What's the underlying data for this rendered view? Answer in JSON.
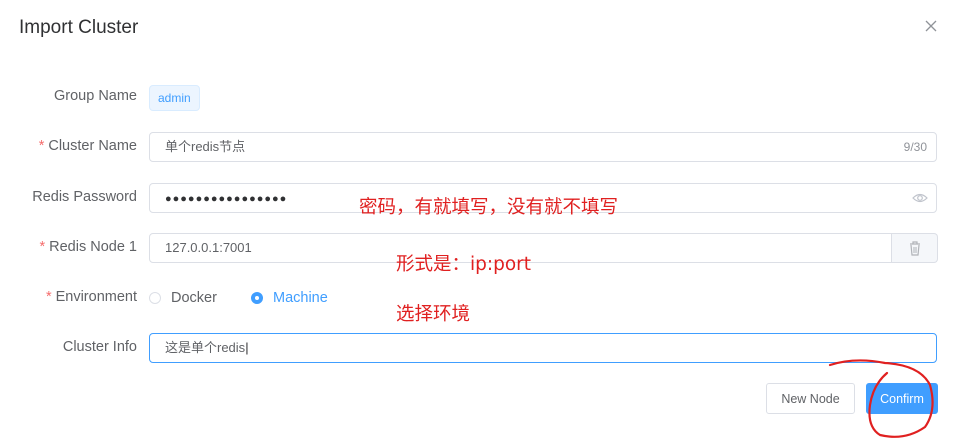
{
  "dialog": {
    "title": "Import Cluster"
  },
  "form": {
    "group_name": {
      "label": "Group Name",
      "value": "admin"
    },
    "cluster_name": {
      "label": "Cluster Name",
      "value": "单个redis节点",
      "count": "9/30",
      "required": "*"
    },
    "redis_password": {
      "label": "Redis Password",
      "masked_value": "●●●●●●●●●●●●●●●●"
    },
    "redis_node_1": {
      "label": "Redis Node 1",
      "value": "127.0.0.1:7001",
      "required": "*"
    },
    "environment": {
      "label": "Environment",
      "required": "*",
      "options": [
        {
          "label": "Docker",
          "selected": false
        },
        {
          "label": "Machine",
          "selected": true
        }
      ]
    },
    "cluster_info": {
      "label": "Cluster Info",
      "value": "这是单个redis"
    }
  },
  "footer": {
    "new_node_label": "New Node",
    "confirm_label": "Confirm"
  },
  "annotations": {
    "password_note": "密码，有就填写，没有就不填写",
    "node_note": "形式是：ip:port",
    "environment_note": "选择环境"
  },
  "colors": {
    "primary": "#409eff",
    "annotation": "#e02020",
    "required": "#f56c6c"
  }
}
